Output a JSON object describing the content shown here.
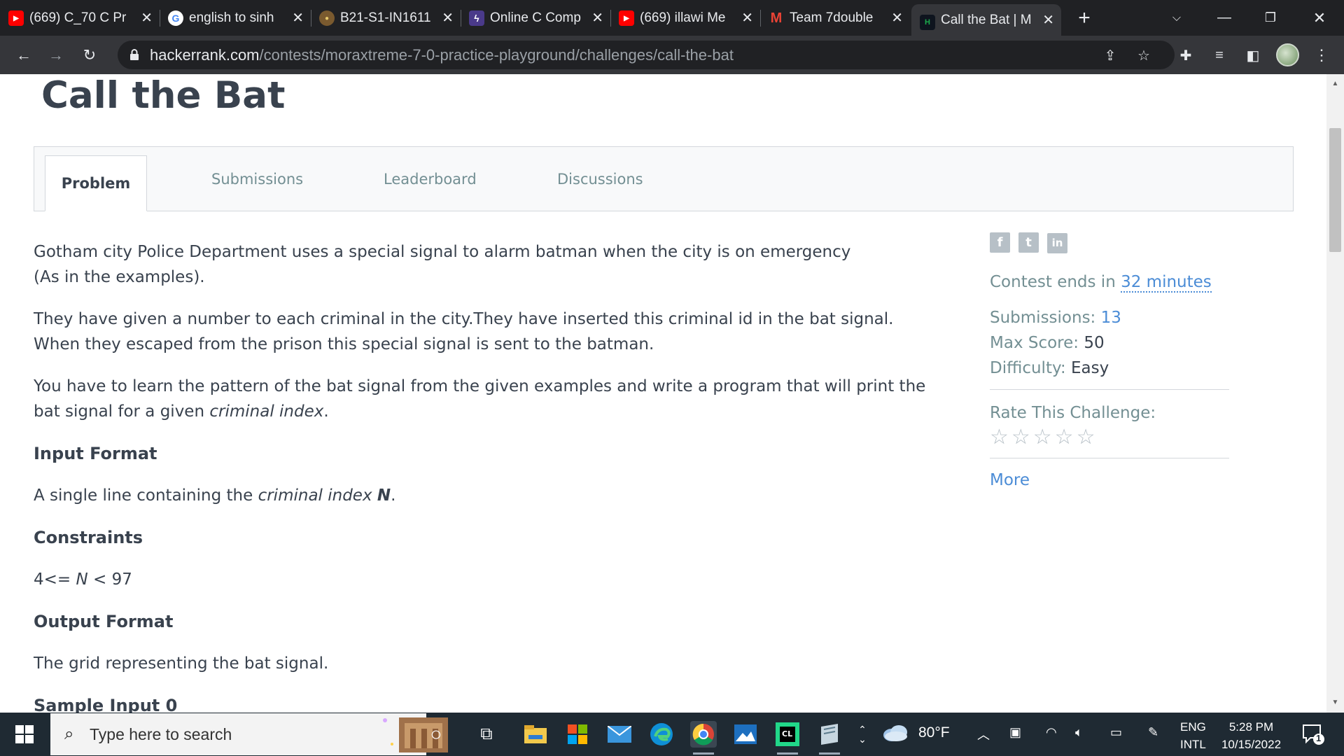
{
  "browser": {
    "tabs": [
      {
        "title": "(669) C_70 C Pr",
        "favicon": "youtube-icon",
        "active": false
      },
      {
        "title": "english to sinh",
        "favicon": "google-icon",
        "active": false
      },
      {
        "title": "B21-S1-IN1611",
        "favicon": "uni-crest-icon",
        "active": false
      },
      {
        "title": "Online C Comp",
        "favicon": "bolt-icon",
        "active": false
      },
      {
        "title": "(669) illawi Me",
        "favicon": "youtube-icon",
        "active": false
      },
      {
        "title": "Team 7double",
        "favicon": "gmail-icon",
        "active": false
      },
      {
        "title": "Call the Bat | M",
        "favicon": "hackerrank-icon",
        "active": true
      }
    ],
    "new_tab_symbol": "+",
    "url_host": "hackerrank.com",
    "url_path": "/contests/moraxtreme-7-0-practice-playground/challenges/call-the-bat"
  },
  "page": {
    "title": "Call the Bat",
    "tabs": [
      "Problem",
      "Submissions",
      "Leaderboard",
      "Discussions"
    ],
    "active_tab": "Problem",
    "problem": {
      "p1a": "Gotham city Police Department uses a special signal to alarm batman when the city is on emergency",
      "p1b": "(As in the examples).",
      "p2a": "They have given a number to each criminal in the city.They have inserted this criminal id in the bat signal.",
      "p2b": "When they escaped from the prison this special signal is sent to the batman.",
      "p3a": "You have to learn the pattern of the bat signal from the given examples and write a program that will print the",
      "p3b": "bat signal for a given ",
      "p3b_em": "criminal index",
      "p3b_end": ".",
      "input_format_heading": "Input Format",
      "input_format_text": "A single line containing the ",
      "input_format_em": "criminal index",
      "input_format_var": "N",
      "input_format_end": ".",
      "constraints_heading": "Constraints",
      "constraints_pre": "4<= ",
      "constraints_var": "N",
      "constraints_post": " < 97",
      "output_format_heading": "Output Format",
      "output_format_text": "The grid representing the bat signal.",
      "sample_input_heading": "Sample Input 0"
    },
    "sidebar": {
      "share_icons": [
        "f",
        "t",
        "in"
      ],
      "contest_ends_label": "Contest ends in ",
      "contest_ends_time": "32 minutes",
      "submissions_label": "Submissions: ",
      "submissions_value": "13",
      "max_score_label": "Max Score: ",
      "max_score_value": "50",
      "difficulty_label": "Difficulty: ",
      "difficulty_value": "Easy",
      "rate_label": "Rate This Challenge:",
      "stars": "☆☆☆☆☆",
      "more_label": "More"
    }
  },
  "taskbar": {
    "search_placeholder": "Type here to search",
    "weather_temp": "80°F",
    "lang_top": "ENG",
    "lang_bottom": "INTL",
    "time": "5:28 PM",
    "date": "10/15/2022",
    "notification_count": "1"
  },
  "colors": {
    "chrome_dark": "#202124",
    "chrome_toolbar": "#35363a",
    "text_primary": "#39424e",
    "text_muted": "#738f93",
    "link": "#4b8cd6",
    "taskbar": "#1f2a33"
  }
}
